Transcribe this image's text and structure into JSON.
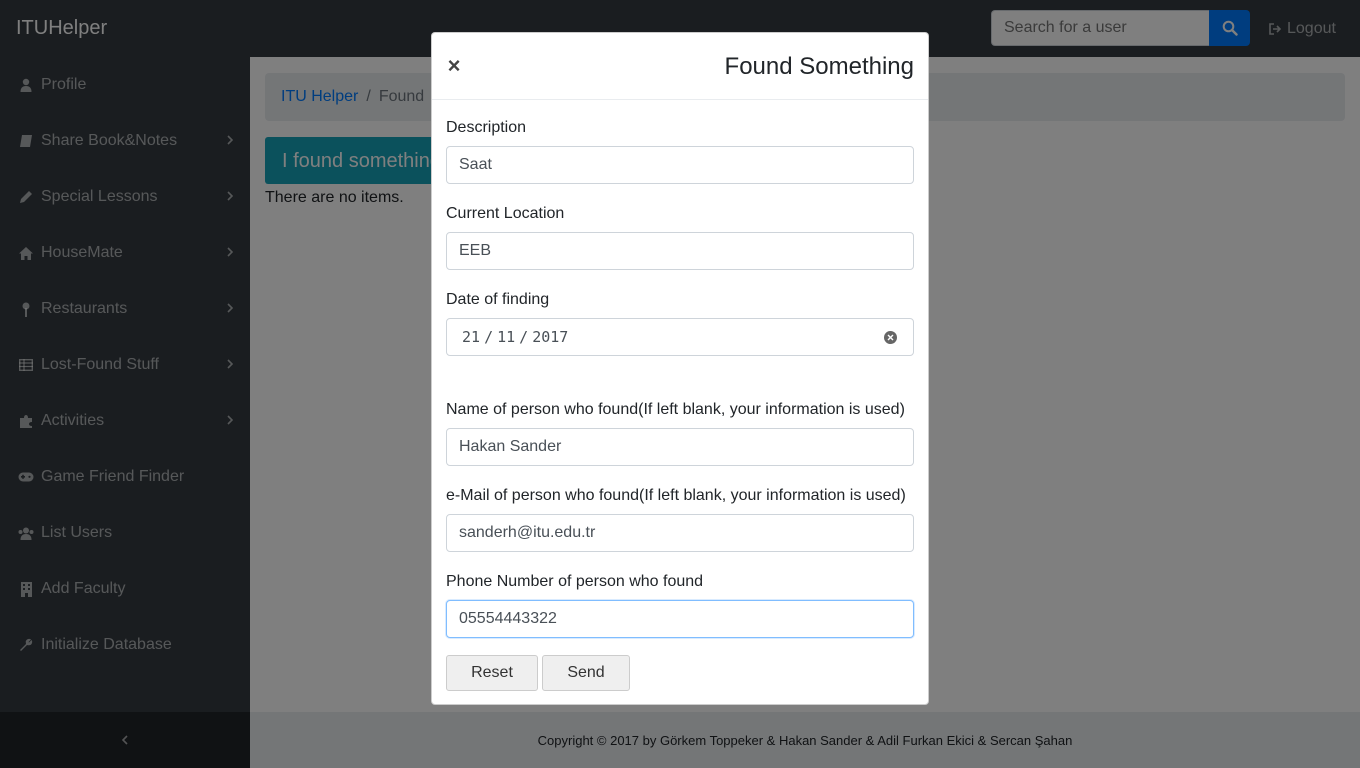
{
  "navbar": {
    "brand": "ITUHelper",
    "search_placeholder": "Search for a user",
    "logout_label": "Logout"
  },
  "sidebar": {
    "items": [
      {
        "label": "Profile",
        "icon": "user-icon",
        "has_submenu": false
      },
      {
        "label": "Share Book&Notes",
        "icon": "book-icon",
        "has_submenu": true
      },
      {
        "label": "Special Lessons",
        "icon": "pencil-icon",
        "has_submenu": true
      },
      {
        "label": "HouseMate",
        "icon": "home-icon",
        "has_submenu": true
      },
      {
        "label": "Restaurants",
        "icon": "map-pin-icon",
        "has_submenu": true
      },
      {
        "label": "Lost-Found Stuff",
        "icon": "table-icon",
        "has_submenu": true
      },
      {
        "label": "Activities",
        "icon": "puzzle-icon",
        "has_submenu": true
      },
      {
        "label": "Game Friend Finder",
        "icon": "gamepad-icon",
        "has_submenu": false
      },
      {
        "label": "List Users",
        "icon": "users-icon",
        "has_submenu": false
      },
      {
        "label": "Add Faculty",
        "icon": "building-icon",
        "has_submenu": false
      },
      {
        "label": "Initialize Database",
        "icon": "wrench-icon",
        "has_submenu": false
      }
    ]
  },
  "breadcrumb": {
    "root": "ITU Helper",
    "current": "Found"
  },
  "main": {
    "found_button_label": "I found something",
    "empty_text": "There are no items."
  },
  "footer": {
    "text": "Copyright © 2017 by Görkem Toppeker & Hakan Sander & Adil Furkan Ekici & Sercan Şahan"
  },
  "modal": {
    "close_symbol": "×",
    "title": "Found Something",
    "description_label": "Description",
    "description_value": "Saat",
    "location_label": "Current Location",
    "location_value": "EEB",
    "date_label": "Date of finding",
    "date_day": "21",
    "date_month": "11",
    "date_year": "2017",
    "name_label": "Name of person who found(If left blank, your information is used)",
    "name_value": "Hakan Sander",
    "email_label": "e-Mail of person who found(If left blank, your information is used)",
    "email_value": "sanderh@itu.edu.tr",
    "phone_label": "Phone Number of person who found",
    "phone_value": "05554443322",
    "reset_label": "Reset",
    "send_label": "Send"
  },
  "colors": {
    "navbar_bg": "#343a40",
    "primary": "#007bff",
    "info": "#17a2b8"
  }
}
